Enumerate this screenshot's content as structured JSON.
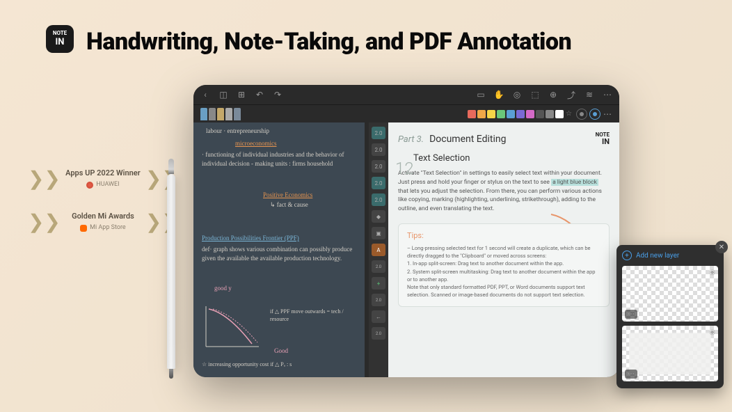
{
  "headline": "Handwriting, Note-Taking, and PDF Annotation",
  "app_icon": {
    "top": "NOTE",
    "bottom": "IN"
  },
  "awards": [
    {
      "title": "Apps UP 2022 Winner",
      "sub": "HUAWEI"
    },
    {
      "title": "Golden Mi Awards",
      "sub": "Mi App Store"
    }
  ],
  "toolbar": {
    "colors": [
      "#e86a5c",
      "#f0a848",
      "#f5d548",
      "#6ac77a",
      "#5a9fd4",
      "#7a6ad4",
      "#d46ac7",
      "#555",
      "#888",
      "#fff"
    ]
  },
  "brush_labels": [
    "2.0",
    "2.0",
    "2.0",
    "2.0",
    "2.0",
    "",
    "",
    "A",
    "2.0",
    "+",
    "2.0",
    "←",
    "2.0"
  ],
  "doc": {
    "part": "Part 3.",
    "part_title": "Document Editing",
    "badge_top": "NOTE",
    "badge_bottom": "IN",
    "section_num": "12",
    "section_title": "Text Selection",
    "body1": "Activate \"Text Selection\" in settings to easily select text within your document. Just press and hold your finger or stylus on the text to see ",
    "highlight": "a light blue block",
    "body2": " that lets you adjust the selection. From there, you can perform various actions like copying, marking (highlighting, underlining, strikethrough), adding to the outline, and even translating the text.",
    "tips_title": "Tips:",
    "tips": "– Long-pressing selected text for 1 second will create a duplicate, which can be directly dragged to the \"Clipboard\" or moved across screens:\n1. In-app split-screen: Drag text to another document within the app.\n2. System split-screen multitasking: Drag text to another document within the app or to another app.\nNote that only standard formatted PDF, PPT, or Word documents support text selection. Scanned or image-based documents do not support text selection."
  },
  "handwriting": {
    "line1": "labour · entrepreneurship",
    "micro": "microeconomics",
    "func": "· functioning of individual industries and the behavior of individual decision - making units : firms household",
    "pos": "Positive Economics",
    "fact": "↳ fact & cause",
    "ppf_title": "Production Possibilities Frontier (PPF)",
    "ppf_def": "def· graph shows various combination can possibly produce given the available the available production technology.",
    "goody": "good y",
    "goodx": "Good",
    "ppf_note": "if △ PPF move outwards = tech / resource",
    "bottom": "☆ increasing opportunity cost   if △ Pₐ : s"
  },
  "layers": {
    "add": "Add new layer"
  }
}
